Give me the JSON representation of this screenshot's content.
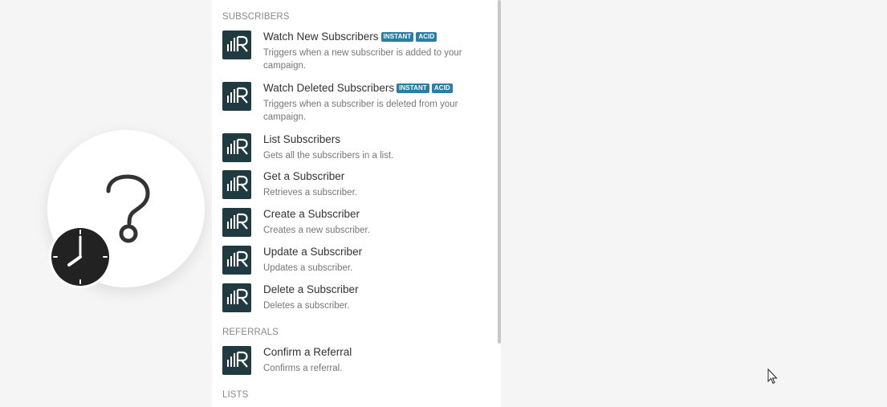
{
  "sections": [
    {
      "header": "SUBSCRIBERS",
      "items": [
        {
          "title": "Watch New Subscribers",
          "badges": [
            "INSTANT",
            "ACID"
          ],
          "desc": "Triggers when a new subscriber is added to your campaign."
        },
        {
          "title": "Watch Deleted Subscribers",
          "badges": [
            "INSTANT",
            "ACID"
          ],
          "desc": "Triggers when a subscriber is deleted from your campaign."
        },
        {
          "title": "List Subscribers",
          "badges": [],
          "desc": "Gets all the subscribers in a list."
        },
        {
          "title": "Get a Subscriber",
          "badges": [],
          "desc": "Retrieves a subscriber."
        },
        {
          "title": "Create a Subscriber",
          "badges": [],
          "desc": "Creates a new subscriber."
        },
        {
          "title": "Update a Subscriber",
          "badges": [],
          "desc": "Updates a subscriber."
        },
        {
          "title": "Delete a Subscriber",
          "badges": [],
          "desc": "Deletes a subscriber."
        }
      ]
    },
    {
      "header": "REFERRALS",
      "items": [
        {
          "title": "Confirm a Referral",
          "badges": [],
          "desc": "Confirms a referral."
        }
      ]
    },
    {
      "header": "LISTS",
      "items": []
    }
  ],
  "icons": {
    "app_logo": "bars-r-logo-icon",
    "placeholder_module": "question-mark-icon",
    "schedule": "clock-icon",
    "pointer": "mouse-cursor-icon"
  },
  "colors": {
    "logo_bg": "#1f3a41",
    "badge_bg": "#2a7ea6",
    "canvas_bg": "#f5f5f5"
  }
}
